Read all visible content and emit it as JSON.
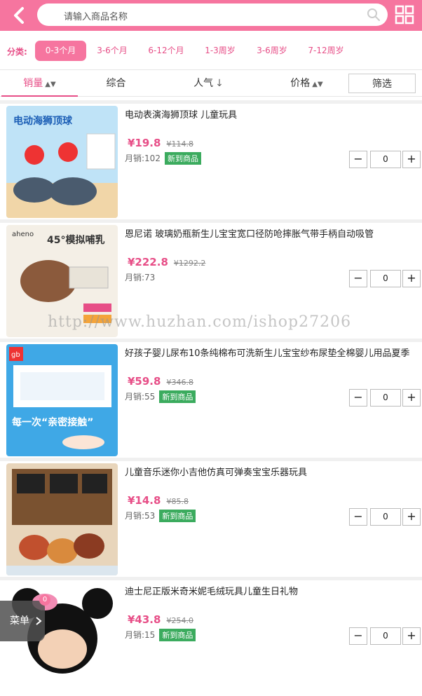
{
  "search": {
    "placeholder": "请输入商品名称"
  },
  "category": {
    "label": "分类:",
    "items": [
      "0-3个月",
      "3-6个月",
      "6-12个月",
      "1-3周岁",
      "3-6周岁",
      "7-12周岁"
    ]
  },
  "sort": {
    "items": [
      {
        "label": "销量",
        "arrow": "▲▼"
      },
      {
        "label": "综合",
        "arrow": ""
      },
      {
        "label": "人气",
        "arrow": "↓"
      },
      {
        "label": "价格",
        "arrow": "▲▼"
      }
    ],
    "filter": "筛选"
  },
  "products": [
    {
      "name": "电动表演海狮顶球 儿童玩具",
      "price": "¥19.8",
      "oprice": "¥114.8",
      "sales": "月销:102",
      "badge": "新到商品",
      "qty": "0",
      "banner": "电动海狮顶球"
    },
    {
      "name": "恩尼诺 玻璃奶瓶新生儿宝宝宽口径防呛摔胀气带手柄自动吸管",
      "price": "¥222.8",
      "oprice": "¥1292.2",
      "sales": "月销:73",
      "badge": "",
      "qty": "0",
      "banner": "45°模拟哺乳"
    },
    {
      "name": "好孩子婴儿尿布10条纯棉布可洗新生儿宝宝纱布尿垫全棉婴儿用品夏季",
      "price": "¥59.8",
      "oprice": "¥346.8",
      "sales": "月销:55",
      "badge": "新到商品",
      "qty": "0",
      "banner": "每一次“亲密接触”"
    },
    {
      "name": "儿童音乐迷你小吉他仿真可弹奏宝宝乐器玩具",
      "price": "¥14.8",
      "oprice": "¥85.8",
      "sales": "月销:53",
      "badge": "新到商品",
      "qty": "0",
      "banner": ""
    },
    {
      "name": "迪士尼正版米奇米妮毛绒玩具儿童生日礼物",
      "price": "¥43.8",
      "oprice": "¥254.0",
      "sales": "月销:15",
      "badge": "新到商品",
      "qty": "0",
      "banner": ""
    }
  ],
  "stepper": {
    "minus": "−",
    "plus": "+"
  },
  "watermark": "http://www.huzhan.com/ishop27206",
  "menu": {
    "label": "菜单",
    "cart_count": "0"
  },
  "colors": {
    "brand": "#f6759f",
    "accent": "#e74e87",
    "badge": "#3bab5e"
  }
}
